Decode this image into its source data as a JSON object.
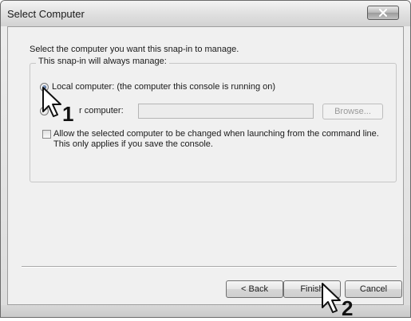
{
  "window": {
    "title": "Select Computer"
  },
  "dialog": {
    "prompt": "Select the computer you want this snap-in to manage.",
    "group_label": "This snap-in will always manage:",
    "local_option": {
      "label": "Local computer:  (the computer this console is running on)",
      "selected": true
    },
    "another_option": {
      "label_visible": "r computer:",
      "selected": false
    },
    "another_computer_value": "",
    "browse_label": "Browse...",
    "allow_change_checkbox": {
      "label": "Allow the selected computer to be changed when launching from the command line.  This only applies if you save the console.",
      "checked": false
    }
  },
  "buttons": {
    "back": "< Back",
    "finish": "Finish",
    "cancel": "Cancel"
  },
  "annotations": {
    "step1": "1",
    "step2": "2"
  },
  "colors": {
    "window_bg": "#f0f0f0",
    "close_glyph": "#ffffff",
    "disabled_text": "#9a9a9a"
  }
}
